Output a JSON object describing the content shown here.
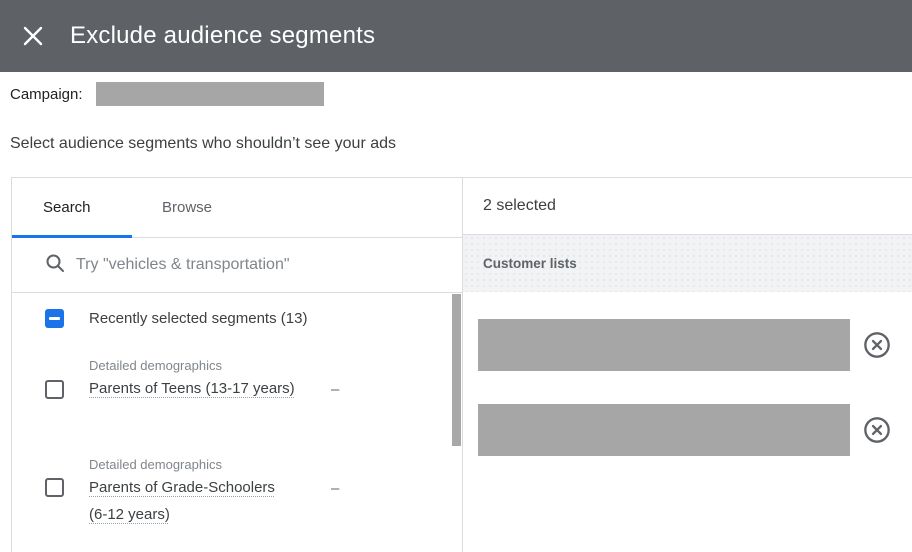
{
  "colors": {
    "header_bg": "#5e6267",
    "accent_blue": "#1a73e8",
    "redaction_gray": "#a6a6a6",
    "border_gray": "#dadce0",
    "section_band_bg": "#f2f3f4",
    "text_dark": "#202124",
    "text_body": "#3c4043",
    "text_gray": "#5f6368"
  },
  "header": {
    "title": "Exclude audience segments",
    "close_icon": "close-icon"
  },
  "campaign": {
    "label": "Campaign:",
    "value_redacted": true
  },
  "instruction": "Select audience segments who shouldn’t see your ads",
  "left_panel": {
    "tabs": [
      {
        "label": "Search",
        "active": true
      },
      {
        "label": "Browse",
        "active": false
      }
    ],
    "search": {
      "icon": "search-icon",
      "placeholder": "Try \"vehicles & transportation\"",
      "value": ""
    },
    "group": {
      "label": "Recently selected segments (13)",
      "checkbox_state": "indeterminate"
    },
    "items": [
      {
        "category": "Detailed demographics",
        "name": "Parents of Teens (13-17 years)",
        "value": "–",
        "checkbox_state": "unchecked"
      },
      {
        "category": "Detailed demographics",
        "name": "Parents of Grade-Schoolers (6-12 years)",
        "value": "–",
        "checkbox_state": "unchecked"
      }
    ],
    "scrollbar": true
  },
  "right_panel": {
    "selected_count": "2 selected",
    "section_title": "Customer lists",
    "items": [
      {
        "redacted": true,
        "remove_icon": "remove-circle-icon"
      },
      {
        "redacted": true,
        "remove_icon": "remove-circle-icon"
      }
    ]
  }
}
